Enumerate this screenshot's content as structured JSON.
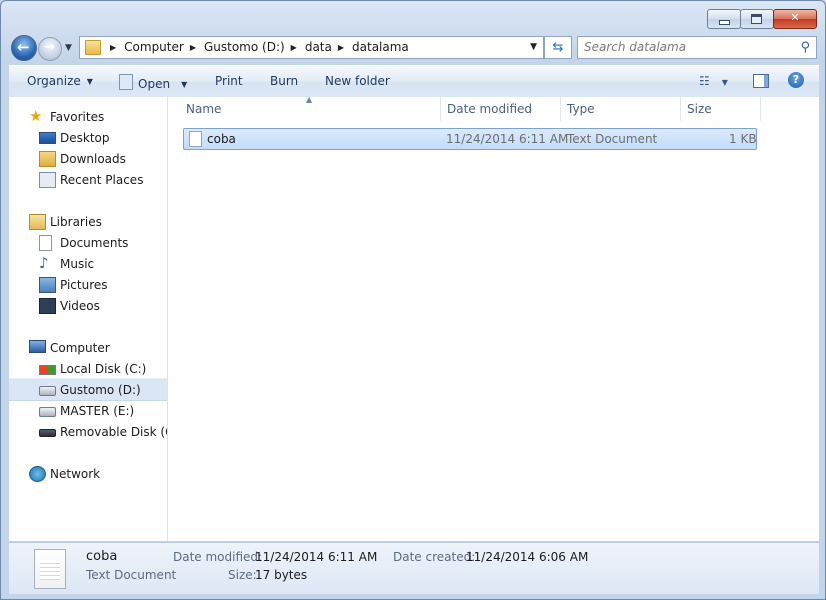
{
  "window": {
    "controls": [
      "minimize",
      "maximize",
      "close"
    ]
  },
  "address": {
    "crumbs": [
      "Computer",
      "Gustomo (D:)",
      "data",
      "datalama"
    ]
  },
  "search": {
    "placeholder": "Search datalama"
  },
  "toolbar": {
    "organize": "Organize",
    "open": "Open",
    "print": "Print",
    "burn": "Burn",
    "new_folder": "New folder"
  },
  "nav": {
    "favorites": {
      "label": "Favorites",
      "items": [
        "Desktop",
        "Downloads",
        "Recent Places"
      ]
    },
    "libraries": {
      "label": "Libraries",
      "items": [
        "Documents",
        "Music",
        "Pictures",
        "Videos"
      ]
    },
    "computer": {
      "label": "Computer",
      "items": [
        "Local Disk (C:)",
        "Gustomo (D:)",
        "MASTER (E:)",
        "Removable Disk (G:)"
      ],
      "selected": "Gustomo (D:)"
    },
    "network": "Network"
  },
  "columns": {
    "name": "Name",
    "date_modified": "Date modified",
    "type": "Type",
    "size": "Size"
  },
  "files": [
    {
      "name": "coba",
      "date_modified": "11/24/2014 6:11 AM",
      "type": "Text Document",
      "size": "1 KB"
    }
  ],
  "details": {
    "name": "coba",
    "type": "Text Document",
    "date_modified_label": "Date modified:",
    "date_modified": "11/24/2014 6:11 AM",
    "date_created_label": "Date created:",
    "date_created": "11/24/2014 6:06 AM",
    "size_label": "Size:",
    "size": "17 bytes"
  }
}
